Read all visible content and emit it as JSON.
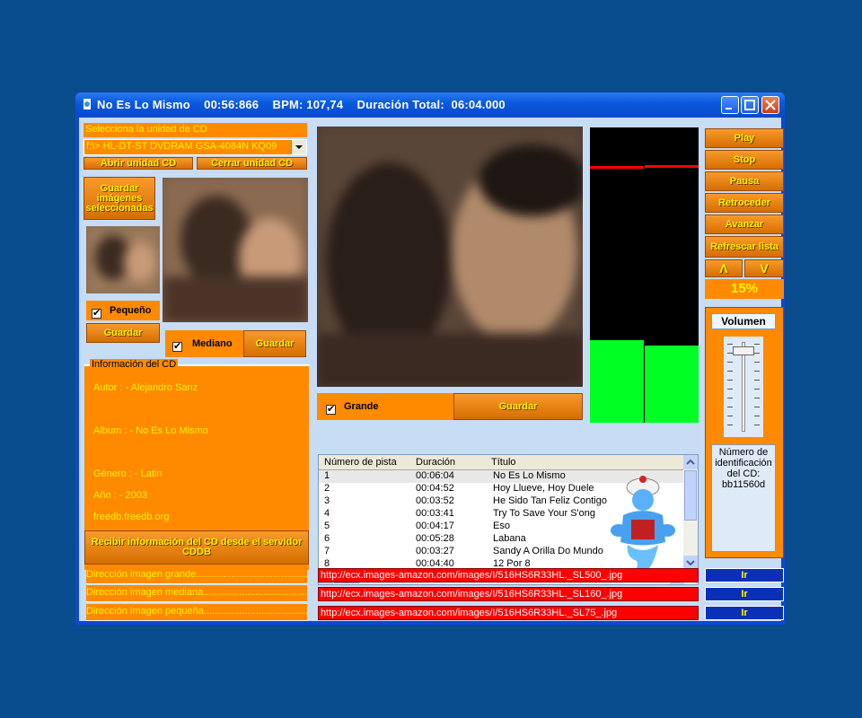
{
  "window": {
    "title": "No Es Lo Mismo    00:56:866    BPM: 107,74    Duración Total:  06:04.000"
  },
  "cd": {
    "select_label": "Selecciona la unidad de CD",
    "drive_value": "f:\\> HL-DT-ST DVDRAM GSA-4084N KQ09",
    "open_btn": "Abrir unidad CD",
    "close_btn": "Cerrar unidad CD"
  },
  "images": {
    "save_selected_btn": "Guardar imágenes seleccionadas",
    "small_label": "Pequeño",
    "medium_label": "Mediano",
    "large_label": "Grande",
    "save_btn": "Guardar"
  },
  "info": {
    "group_title": "Información del CD",
    "author": "Autor : - Alejandro Sanz",
    "album": "Album : - No Es Lo Mismo",
    "genre": "Género : -  Latin",
    "year": "Año : - 2003",
    "server": "freedb.freedb.org",
    "fetch_btn": "Recibir información del CD desde el servidor CDDB"
  },
  "addresses": {
    "large": "Dirección imagen grande.........................................................",
    "medium": "Dirección imagen mediana.......................................................",
    "small": "Dirección imagen pequeña........................................................"
  },
  "controls": {
    "play": "Play",
    "stop": "Stop",
    "pause": "Pausa",
    "rewind": "Retroceder",
    "forward": "Avanzar",
    "refresh": "Refrescar lista",
    "up": "Λ",
    "down": "V",
    "percent": "15%",
    "volume_label": "Volumen",
    "volume_level": 0.95,
    "cd_id_text": "Número de identificación del CD: bb11560d"
  },
  "meter": {
    "left_level": 0.28,
    "right_level": 0.26
  },
  "tracks": {
    "columns": [
      "Número de pista",
      "Duración",
      "Título"
    ],
    "rows": [
      {
        "n": "1",
        "dur": "00:06:04",
        "title": "No Es Lo Mismo"
      },
      {
        "n": "2",
        "dur": "00:04:52",
        "title": "Hoy Llueve, Hoy Duele"
      },
      {
        "n": "3",
        "dur": "00:03:52",
        "title": "He Sido Tan Feliz Contigo"
      },
      {
        "n": "4",
        "dur": "00:03:41",
        "title": "Try To Save Your S'ong"
      },
      {
        "n": "5",
        "dur": "00:04:17",
        "title": "Eso"
      },
      {
        "n": "6",
        "dur": "00:05:28",
        "title": "Labana"
      },
      {
        "n": "7",
        "dur": "00:03:27",
        "title": "Sandy A Orilla Do Mundo"
      },
      {
        "n": "8",
        "dur": "00:04:40",
        "title": "12 Por 8"
      }
    ]
  },
  "urls": {
    "large": "http://ecx.images-amazon.com/images/I/516HS6R33HL._SL500_.jpg",
    "medium": "http://ecx.images-amazon.com/images/I/516HS6R33HL._SL160_.jpg",
    "small": "http://ecx.images-amazon.com/images/I/516HS6R33HL._SL75_.jpg",
    "go_btn": "Ir"
  }
}
